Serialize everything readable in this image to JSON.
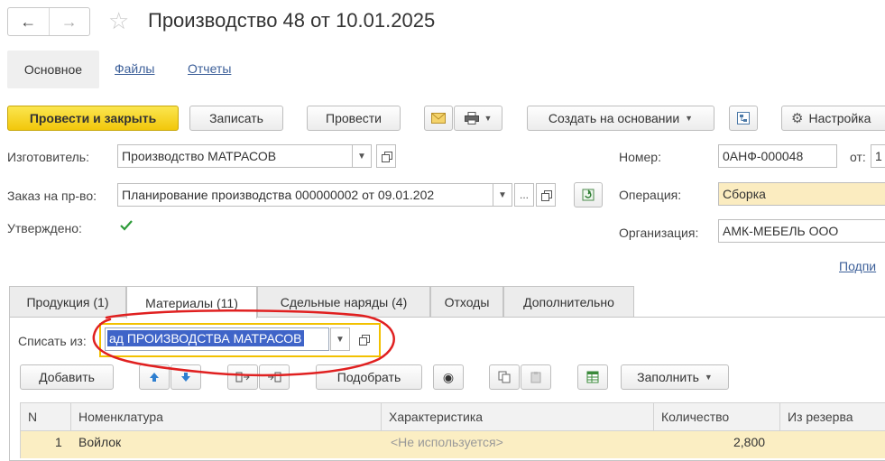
{
  "window": {
    "title": "Производство 48 от 10.01.2025"
  },
  "sections": {
    "main": "Основное",
    "files": "Файлы",
    "reports": "Отчеты"
  },
  "toolbar": {
    "post_close": "Провести и закрыть",
    "save": "Записать",
    "post": "Провести",
    "create_based": "Создать на основании",
    "settings": "Настройка"
  },
  "form": {
    "manufacturer_label": "Изготовитель:",
    "manufacturer_value": "Производство МАТРАСОВ",
    "order_label": "Заказ на пр-во:",
    "order_value": "Планирование производства 000000002 от 09.01.202",
    "approved_label": "Утверждено:",
    "approved": true,
    "number_label": "Номер:",
    "number_value": "0АНФ-000048",
    "date_label": "от:",
    "date_value": "1",
    "operation_label": "Операция:",
    "operation_value": "Сборка",
    "org_label": "Организация:",
    "org_value": "АМК-МЕБЕЛЬ ООО",
    "sign_link": "Подпи"
  },
  "tabs": [
    {
      "label": "Продукция (1)",
      "active": false
    },
    {
      "label": "Материалы (11)",
      "active": true
    },
    {
      "label": "Сдельные наряды (4)",
      "active": false
    },
    {
      "label": "Отходы",
      "active": false
    },
    {
      "label": "Дополнительно",
      "active": false
    }
  ],
  "materials": {
    "writeoff_label": "Списать из:",
    "writeoff_value": "ад ПРОИЗВОДСТВА  МАТРАСОВ",
    "add": "Добавить",
    "pick": "Подобрать",
    "fill": "Заполнить"
  },
  "table": {
    "columns": [
      "N",
      "Номенклатура",
      "Характеристика",
      "Количество",
      "Из резерва"
    ],
    "rows": [
      {
        "n": "1",
        "item": "Войлок",
        "characteristic": "<Не используется>",
        "quantity": "2,800",
        "reserve": ""
      }
    ]
  },
  "colors": {
    "accent_yellow": "#f5d21a",
    "selection_blue": "#3f64c8",
    "annotation_red": "#e02020",
    "focus_outline": "#f2c100"
  }
}
